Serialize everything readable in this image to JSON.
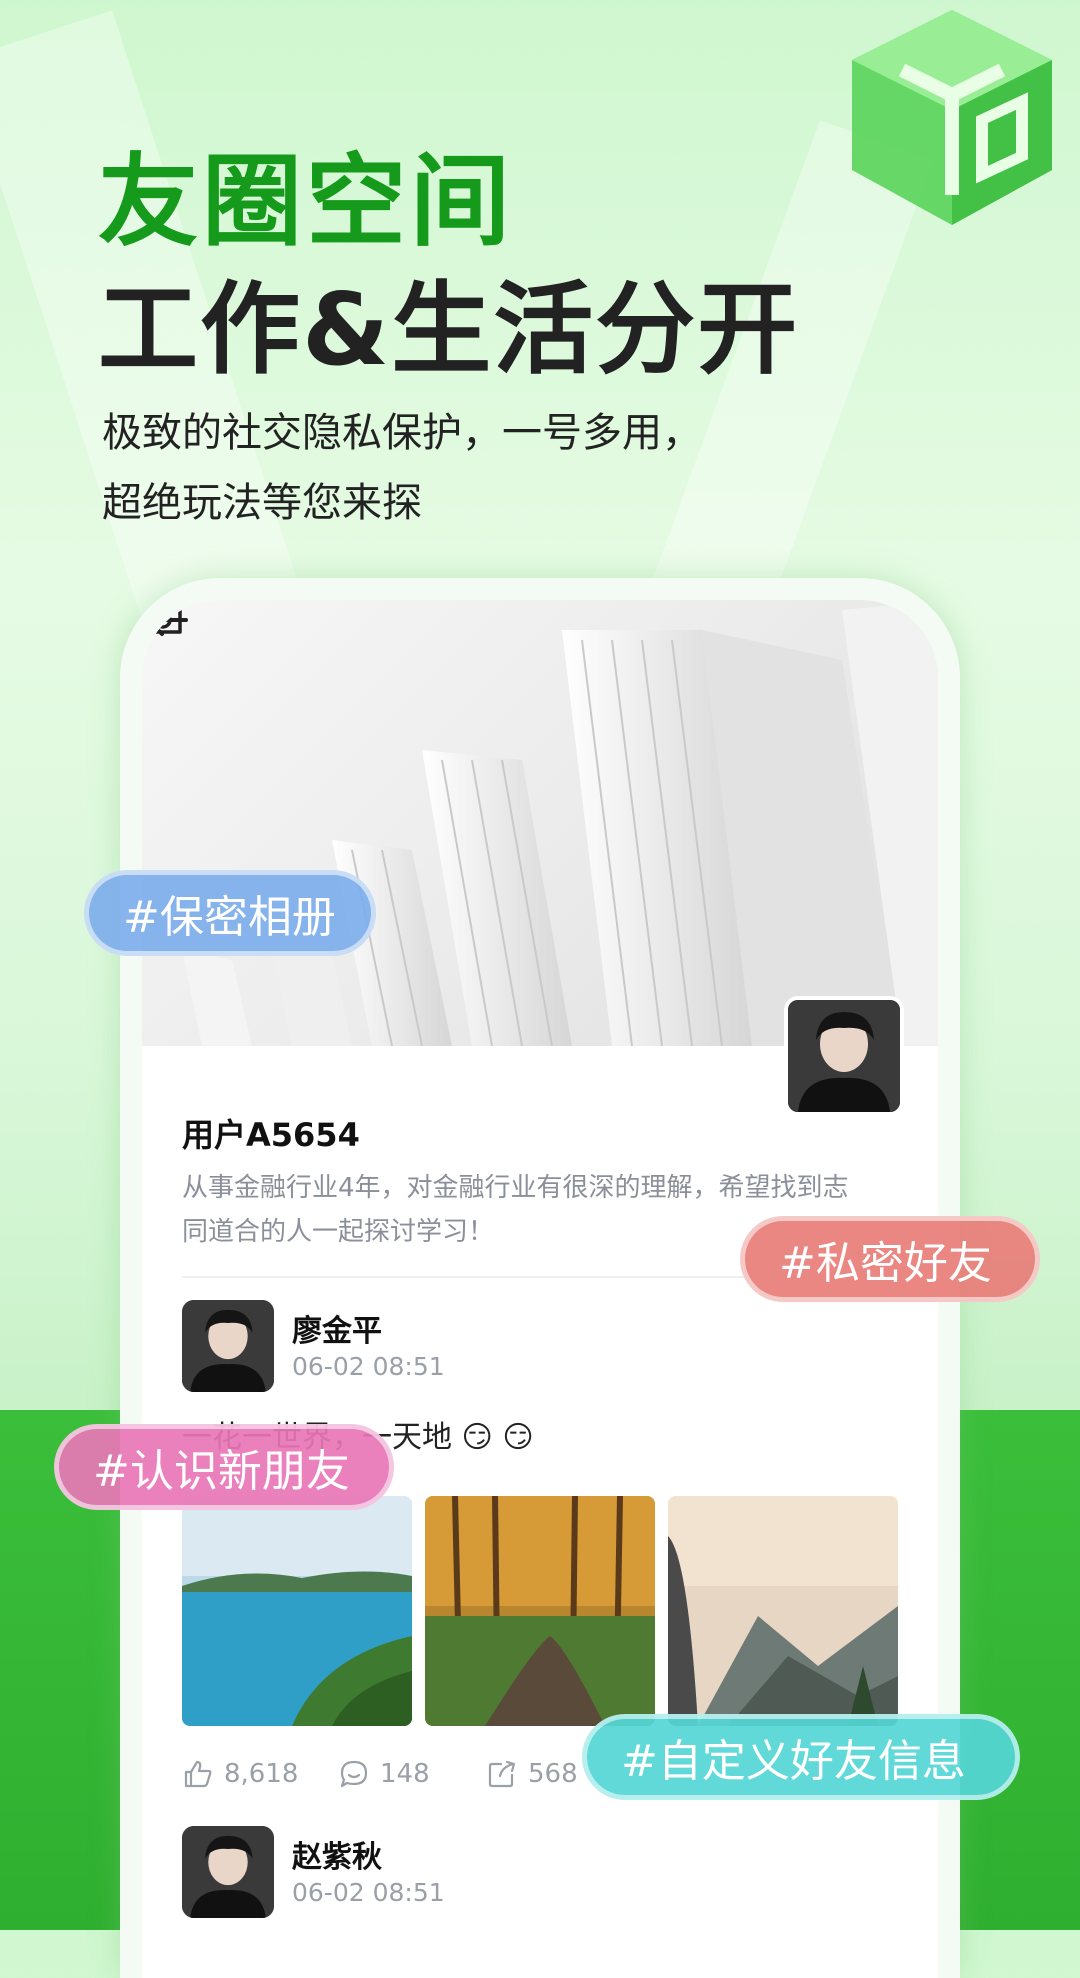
{
  "header": {
    "title": "友圈空间",
    "headline": "工作&生活分开",
    "subtitle_line1": "极致的社交隐私保护，一号多用，",
    "subtitle_line2": "超绝玩法等您来探"
  },
  "profile": {
    "name": "用户A5654",
    "bio_line1": "从事金融行业4年，对金融行业有很深的理解，希望找到志",
    "bio_line2": "同道合的人一起探讨学习！"
  },
  "posts": [
    {
      "author": "廖金平",
      "time": "06-02 08:51",
      "text": "一花一世界，一天地 😏 😏",
      "likes": "8,618",
      "comments": "148",
      "shares": "568"
    },
    {
      "author": "赵紫秋",
      "time": "06-02 08:51"
    }
  ],
  "tags": {
    "album": "#保密相册",
    "friends": "#私密好友",
    "new_friends": "#认识新朋友",
    "custom_info": "#自定义好友信息"
  },
  "icons": {
    "back": "back-arrow-icon",
    "camera": "camera-icon",
    "like": "thumbs-up-icon",
    "comment": "comment-icon",
    "share": "share-icon",
    "cube": "cube-logo-icon"
  },
  "colors": {
    "brand_green": "#159a1b",
    "band_green": "#36b936",
    "tag_blue": "#7daeea",
    "tag_red": "#e87d78",
    "tag_pink": "#e876b6",
    "tag_cyan": "#54d6d6"
  }
}
